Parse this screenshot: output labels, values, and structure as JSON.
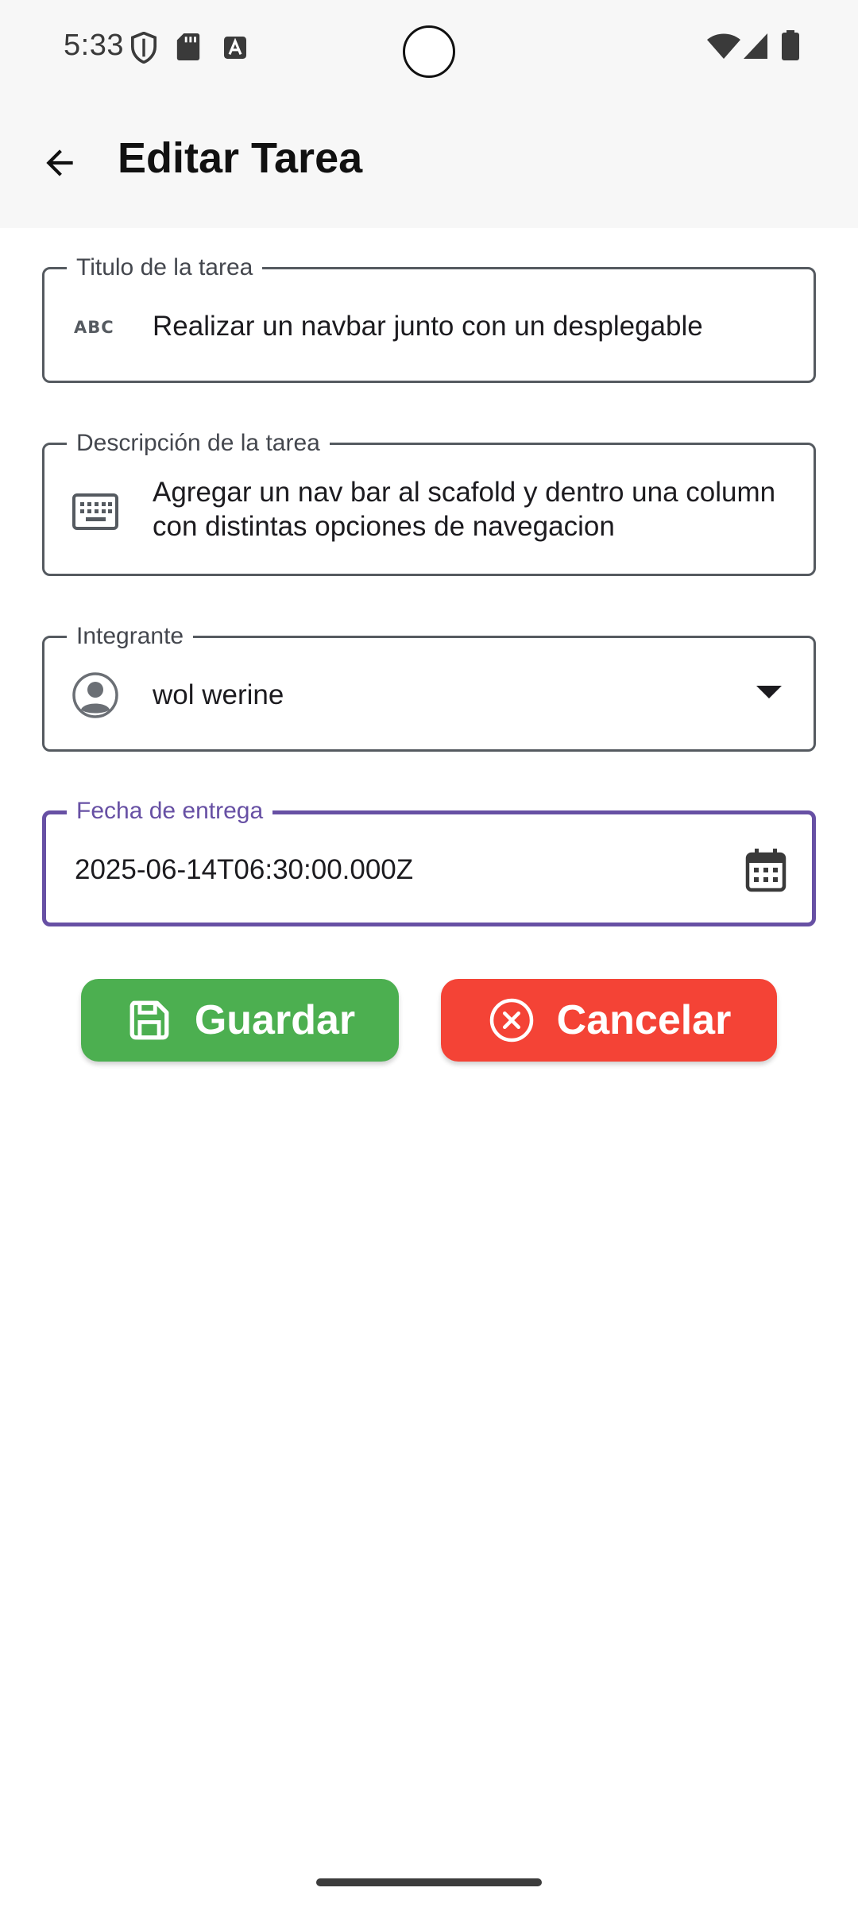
{
  "status_bar": {
    "time": "5:33",
    "icons_left": [
      "shield-icon",
      "sd-card-icon",
      "font-a-icon"
    ],
    "icons_right": [
      "wifi-icon",
      "signal-icon",
      "battery-icon"
    ]
  },
  "app_bar": {
    "title": "Editar Tarea",
    "back_icon": "arrow-back-icon"
  },
  "form": {
    "titulo": {
      "label": "Titulo de la tarea",
      "value": "Realizar un navbar junto con un desplegable",
      "icon": "abc-icon"
    },
    "descripcion": {
      "label": "Descripción de la tarea",
      "value": "Agregar un nav bar al scafold y dentro una column con distintas opciones de navegacion",
      "icon": "keyboard-icon"
    },
    "integrante": {
      "label": "Integrante",
      "value": "wol werine",
      "icon": "account-circle-icon",
      "trailing_icon": "dropdown-arrow-icon"
    },
    "fecha": {
      "label": "Fecha de entrega",
      "value": "2025-06-14T06:30:00.000Z",
      "trailing_icon": "calendar-icon",
      "focused": true
    }
  },
  "buttons": {
    "save": {
      "label": "Guardar",
      "icon": "save-icon",
      "color": "#4caf50"
    },
    "cancel": {
      "label": "Cancelar",
      "icon": "cancel-circle-icon",
      "color": "#f44336"
    }
  },
  "colors": {
    "accent": "#6750a4",
    "outline": "#555a60",
    "surface": "#f7f7f7"
  }
}
